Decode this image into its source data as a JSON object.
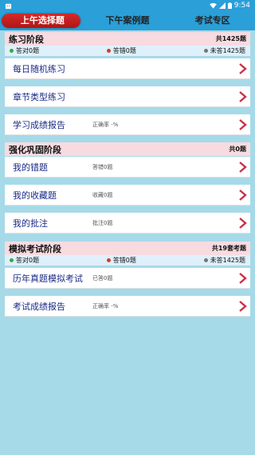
{
  "status_bar": {
    "time": "9:54"
  },
  "tabs": [
    {
      "label": "上午选择题"
    },
    {
      "label": "下午案例题"
    },
    {
      "label": "考试专区"
    }
  ],
  "practice": {
    "title": "练习阶段",
    "count": "共1425题",
    "stats": {
      "correct": "答对0题",
      "wrong": "答错0题",
      "unanswered": "未答1425题"
    },
    "items": [
      {
        "label": "每日随机练习",
        "sub": ""
      },
      {
        "label": "章节类型练习",
        "sub": ""
      },
      {
        "label": "学习成绩报告",
        "sub": "正确率 -%"
      }
    ]
  },
  "reinforce": {
    "title": "强化巩固阶段",
    "count": "共0题",
    "items": [
      {
        "label": "我的错题",
        "sub": "答错0题"
      },
      {
        "label": "我的收藏题",
        "sub": "收藏0题"
      },
      {
        "label": "我的批注",
        "sub": "批注0题"
      }
    ]
  },
  "mock": {
    "title": "模拟考试阶段",
    "count": "共19套考题",
    "stats": {
      "correct": "答对0题",
      "wrong": "答错0题",
      "unanswered": "未答1425题"
    },
    "items": [
      {
        "label": "历年真题模拟考试",
        "sub": "已答0题"
      },
      {
        "label": "考试成绩报告",
        "sub": "正确率 -%"
      }
    ]
  },
  "colors": {
    "accent": "#2a9fd8",
    "active_tab": "#c62020",
    "arrow": "#c8324a",
    "background": "#a6dae8"
  }
}
